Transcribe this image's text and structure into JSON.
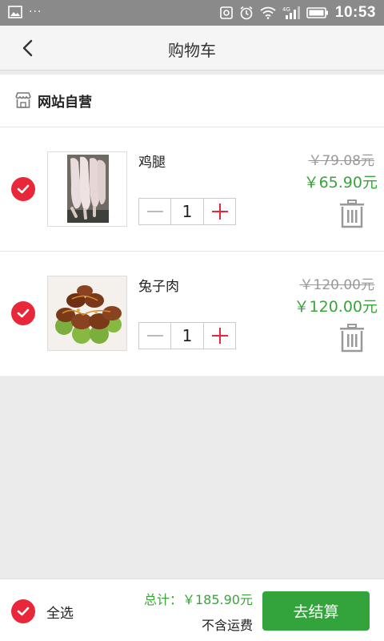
{
  "status_bar": {
    "time": "10:53",
    "notification_dots": "···",
    "icons": [
      "image-icon",
      "screenshot-icon",
      "alarm-icon",
      "wifi-icon",
      "4g-signal-icon",
      "battery-icon"
    ]
  },
  "nav": {
    "title": "购物车",
    "back_icon": "chevron-left-icon"
  },
  "shop": {
    "name": "网站自营",
    "icon": "store-icon"
  },
  "items": [
    {
      "name": "鸡腿",
      "quantity": "1",
      "original_price": "￥79.08元",
      "price": "￥65.90元",
      "checked": true
    },
    {
      "name": "兔子肉",
      "quantity": "1",
      "original_price": "￥120.00元",
      "price": "￥120.00元",
      "checked": true
    }
  ],
  "footer": {
    "select_all": "全选",
    "total_label": "总计：",
    "total_value": "￥185.90元",
    "shipping_note": "不含运费",
    "checkout": "去结算"
  },
  "colors": {
    "accent_red": "#e8273a",
    "price_green": "#3aa33a",
    "checkout_green": "#33a43b",
    "status_bar": "#8a8a8a"
  }
}
